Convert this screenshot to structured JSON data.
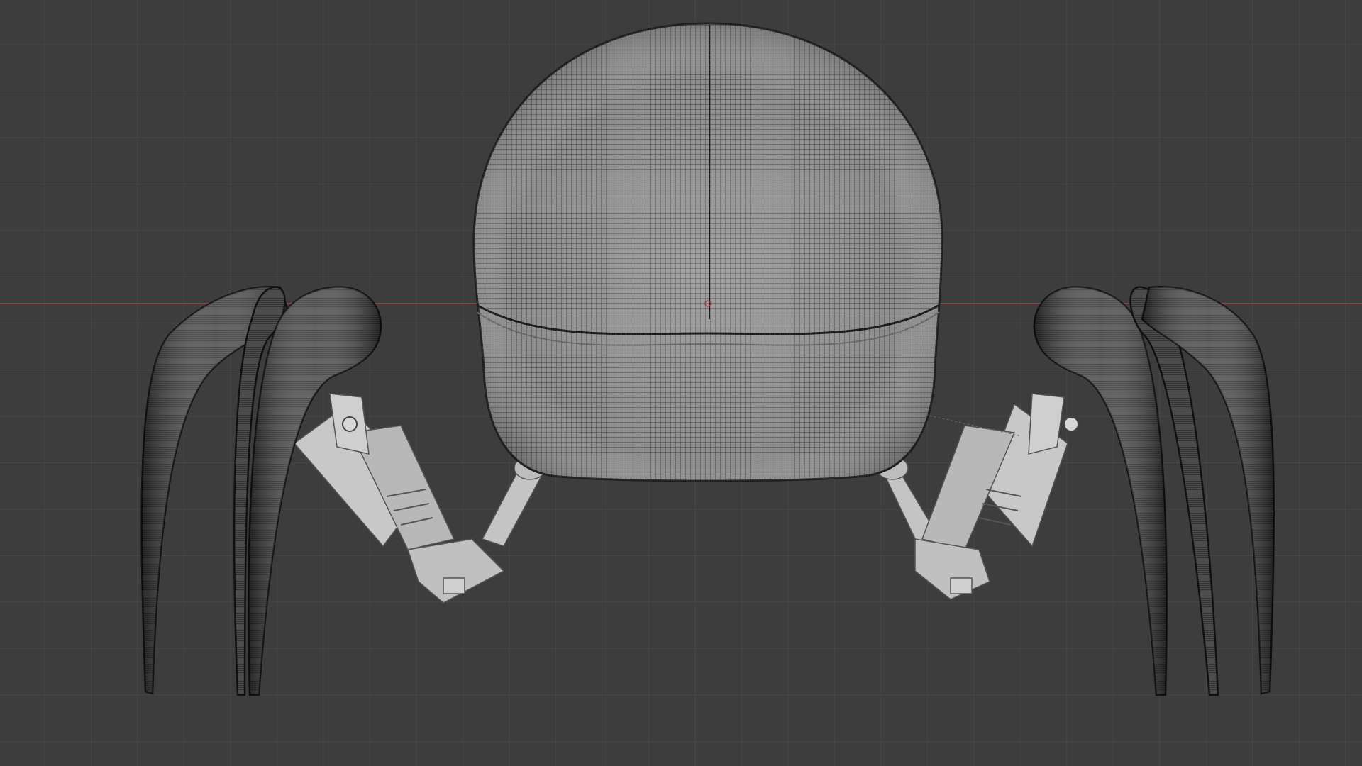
{
  "viewport": {
    "background_color": "#3d3d3d",
    "grid_color": "#4a4a4a",
    "x_axis_color": "#9a4a50",
    "mesh_body_color": "#8c8c8c",
    "mesh_wire_color": "#2a2a2a",
    "leg_color": "#bdbdbd",
    "claw_color": "#5a5a5a"
  }
}
